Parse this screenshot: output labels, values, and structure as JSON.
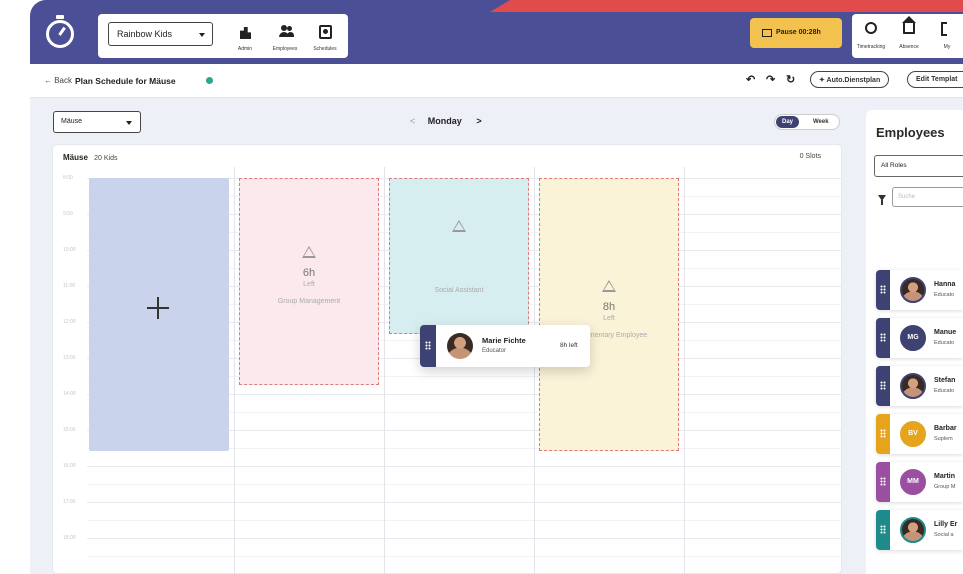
{
  "header": {
    "organization": "Rainbow Kids",
    "nav": [
      {
        "label": "Admin",
        "icon": "building-icon"
      },
      {
        "label": "Employees",
        "icon": "users-icon"
      },
      {
        "label": "Schedules",
        "icon": "schedule-icon"
      }
    ],
    "pause_label": "Pause 00:28h",
    "right_nav": [
      {
        "label": "Timetracking",
        "icon": "timer-icon"
      },
      {
        "label": "Absence",
        "icon": "home-icon"
      },
      {
        "label": "My",
        "icon": "profile-icon"
      }
    ]
  },
  "subbar": {
    "back": "← Back",
    "title": "Plan Schedule for Mäuse",
    "status_color": "#2aa88e",
    "undo": "↶",
    "redo": "↷",
    "refresh": "↻",
    "auto_plan": "✦ Auto.Dienstplan",
    "edit_template": "Edit Templat"
  },
  "schedule": {
    "group_select": "Mäuse",
    "day": "Monday",
    "prev": "<",
    "next": ">",
    "view_day": "Day",
    "view_week": "Week",
    "group_name": "Mäuse",
    "kids": "20 Kids",
    "slots": "0 Slots",
    "times": [
      "8:00",
      "9:00",
      "10:00",
      "11:00",
      "12:00",
      "13:00",
      "14:00",
      "15:00",
      "16:00",
      "17:00",
      "18:00"
    ],
    "shifts": [
      {
        "hours": "6h",
        "left": "Left",
        "role": "Group Management"
      },
      {
        "hours": "",
        "left": "",
        "role": "Social Assistant"
      },
      {
        "hours": "8h",
        "left": "Left",
        "role": "Suplementary Employee"
      }
    ],
    "dragging": {
      "name": "Marie Fichte",
      "role": "Educator",
      "left": "8h left"
    }
  },
  "employees": {
    "title": "Employees",
    "roles_select": "All Roles",
    "search_placeholder": "Suche",
    "list": [
      {
        "name": "Hanna",
        "role": "Educato",
        "color": "#3e4272",
        "initials": ""
      },
      {
        "name": "Manue",
        "role": "Educato",
        "color": "#3e4272",
        "initials": "MG"
      },
      {
        "name": "Stefan",
        "role": "Educato",
        "color": "#3e4272",
        "initials": ""
      },
      {
        "name": "Barbar",
        "role": "Suplem",
        "color": "#e6a31c",
        "initials": "BV"
      },
      {
        "name": "Martin",
        "role": "Group M",
        "color": "#9b4fa0",
        "initials": "MM"
      },
      {
        "name": "Lilly Er",
        "role": "Social a",
        "color": "#1f8a8a",
        "initials": ""
      }
    ]
  }
}
